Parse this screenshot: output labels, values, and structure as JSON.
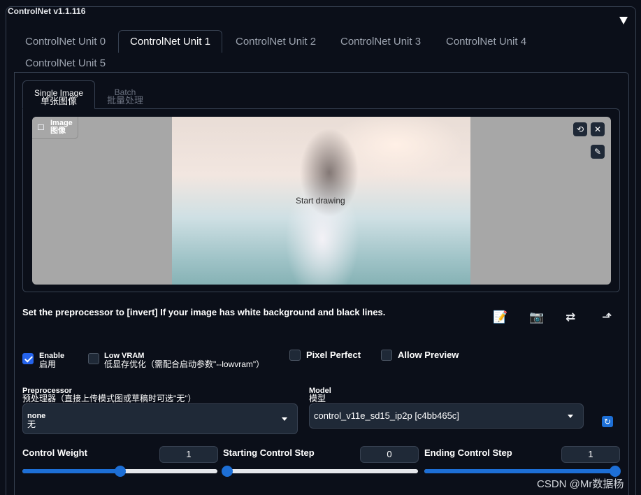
{
  "panel": {
    "title": "ControlNet v1.1.116"
  },
  "unit_tabs": [
    "ControlNet Unit 0",
    "ControlNet Unit 1",
    "ControlNet Unit 2",
    "ControlNet Unit 3",
    "ControlNet Unit 4",
    "ControlNet Unit 5"
  ],
  "active_unit_tab": "ControlNet Unit 1",
  "image_tabs": [
    {
      "en": "Single Image",
      "zh": "单张图像"
    },
    {
      "en": "Batch",
      "zh": "批量处理"
    }
  ],
  "canvas": {
    "label_en": "Image",
    "label_zh": "图像",
    "overlay_text": "Start drawing",
    "icons": [
      "undo-icon",
      "close-icon",
      "brush-icon"
    ]
  },
  "hint": "Set the preprocessor to [invert] If your image has white background and black lines.",
  "toolbar_icons": [
    "memo-icon",
    "camera-icon",
    "swap-icon",
    "send-icon"
  ],
  "checkboxes": {
    "enable": {
      "en": "Enable",
      "zh": "启用",
      "checked": true
    },
    "low_vram": {
      "en": "Low VRAM",
      "zh": "低显存优化（需配合启动参数\"--lowvram\"）",
      "checked": false
    },
    "pixel_perfect": {
      "label": "Pixel Perfect",
      "checked": false
    },
    "allow_preview": {
      "label": "Allow Preview",
      "checked": false
    }
  },
  "preprocessor": {
    "label_en": "Preprocessor",
    "label_zh": "预处理器（直接上传模式图或草稿时可选\"无\"）",
    "value_en": "none",
    "value_zh": "无"
  },
  "model": {
    "label_en": "Model",
    "label_zh": "模型",
    "value": "control_v11e_sd15_ip2p [c4bb465c]"
  },
  "sliders": {
    "control_weight": {
      "label": "Control Weight",
      "value": "1",
      "fraction": 0.5
    },
    "starting_step": {
      "label": "Starting Control Step",
      "value": "0",
      "fraction": 0.0
    },
    "ending_step": {
      "label": "Ending Control Step",
      "value": "1",
      "fraction": 1.0
    }
  },
  "watermark": "CSDN @Mr数据杨",
  "accent_color": "#1d6fd6"
}
